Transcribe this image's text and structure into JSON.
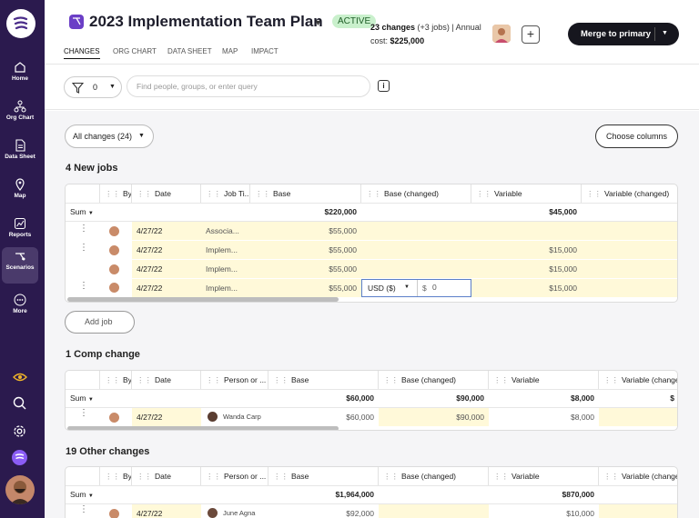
{
  "nav": {
    "home": "Home",
    "org_chart": "Org Chart",
    "data_sheet": "Data Sheet",
    "map": "Map",
    "reports": "Reports",
    "scenarios": "Scenarios",
    "more": "More"
  },
  "header": {
    "title": "2023 Implementation Team Plan",
    "status": "ACTIVE",
    "changes_count": "23 changes",
    "changes_jobs": "(+3 jobs)",
    "annual_label": "| Annual cost:",
    "annual_cost": "$225,000",
    "merge_label": "Merge to primary"
  },
  "tabs": [
    "CHANGES",
    "ORG CHART",
    "DATA SHEET",
    "MAP",
    "IMPACT"
  ],
  "filter": {
    "count": "0",
    "search_placeholder": "Find people, groups, or enter query"
  },
  "toolbar": {
    "all_changes": "All changes (24)",
    "choose_columns": "Choose columns"
  },
  "sections": {
    "new_jobs": {
      "title": "4 New jobs",
      "headers": [
        "By",
        "Date",
        "Job Ti...",
        "Base",
        "Base (changed)",
        "Variable",
        "Variable (changed)"
      ],
      "sum_label": "Sum",
      "sum_base": "$220,000",
      "sum_variable": "$45,000",
      "rows": [
        {
          "date": "4/27/22",
          "job": "Associa...",
          "base": "$55,000",
          "variable": ""
        },
        {
          "date": "4/27/22",
          "job": "Implem...",
          "base": "$55,000",
          "variable": "$15,000"
        },
        {
          "date": "4/27/22",
          "job": "Implem...",
          "base": "$55,000",
          "variable": "$15,000"
        },
        {
          "date": "4/27/22",
          "job": "Implem...",
          "base": "$55,000",
          "variable": "$15,000"
        }
      ],
      "edit_currency": "USD ($)",
      "edit_prefix": "$",
      "edit_value": "0",
      "add_job": "Add job"
    },
    "comp_change": {
      "title": "1 Comp change",
      "headers": [
        "By",
        "Date",
        "Person or ...",
        "Base",
        "Base (changed)",
        "Variable",
        "Variable (changed)"
      ],
      "sum_label": "Sum",
      "sum_base": "$60,000",
      "sum_base_changed": "$90,000",
      "sum_variable": "$8,000",
      "sum_variable_changed": "$",
      "rows": [
        {
          "date": "4/27/22",
          "person": "Wanda Carp",
          "base": "$60,000",
          "base_changed": "$90,000",
          "variable": "$8,000"
        }
      ]
    },
    "other_changes": {
      "title": "19 Other changes",
      "headers": [
        "By",
        "Date",
        "Person or ...",
        "Base",
        "Base (changed)",
        "Variable",
        "Variable (changed)"
      ],
      "sum_label": "Sum",
      "sum_base": "$1,964,000",
      "sum_variable": "$870,000",
      "rows": [
        {
          "date": "4/27/22",
          "person": "June Agna",
          "base": "$92,000",
          "variable": "$10,000"
        }
      ]
    }
  }
}
